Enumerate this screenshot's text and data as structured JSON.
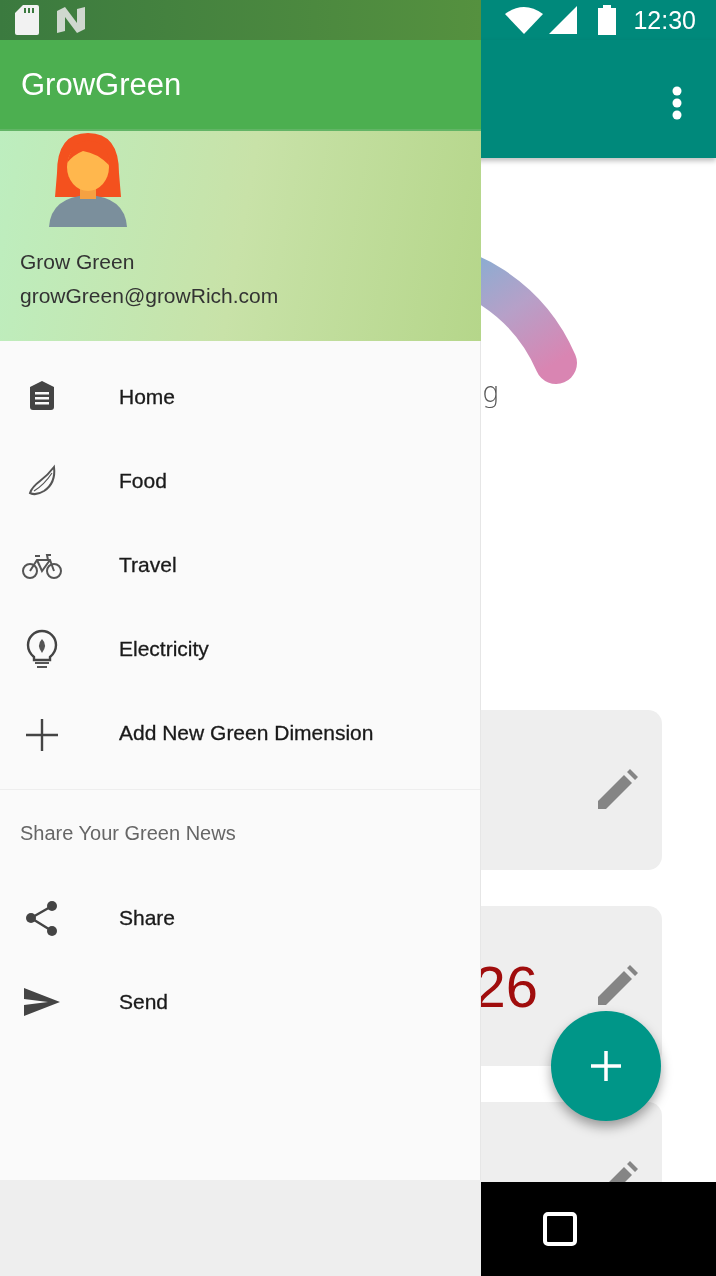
{
  "status_bar": {
    "time": "12:30"
  },
  "drawer": {
    "app_title": "GrowGreen",
    "profile": {
      "name": "Grow Green",
      "email": "growGreen@growRich.com"
    },
    "items": [
      {
        "kind": "home",
        "label": "Home"
      },
      {
        "kind": "food",
        "label": "Food"
      },
      {
        "kind": "travel",
        "label": "Travel"
      },
      {
        "kind": "electricity",
        "label": "Electricity"
      },
      {
        "kind": "add",
        "label": "Add New Green Dimension"
      }
    ],
    "section": {
      "title": "Share Your Green News",
      "items": [
        {
          "kind": "share",
          "label": "Share"
        },
        {
          "kind": "send",
          "label": "Send"
        }
      ]
    }
  },
  "background": {
    "gauge_label": "g",
    "cards": [
      {
        "kind": "plain"
      },
      {
        "kind": "value",
        "value": "26"
      },
      {
        "kind": "plain"
      }
    ]
  }
}
